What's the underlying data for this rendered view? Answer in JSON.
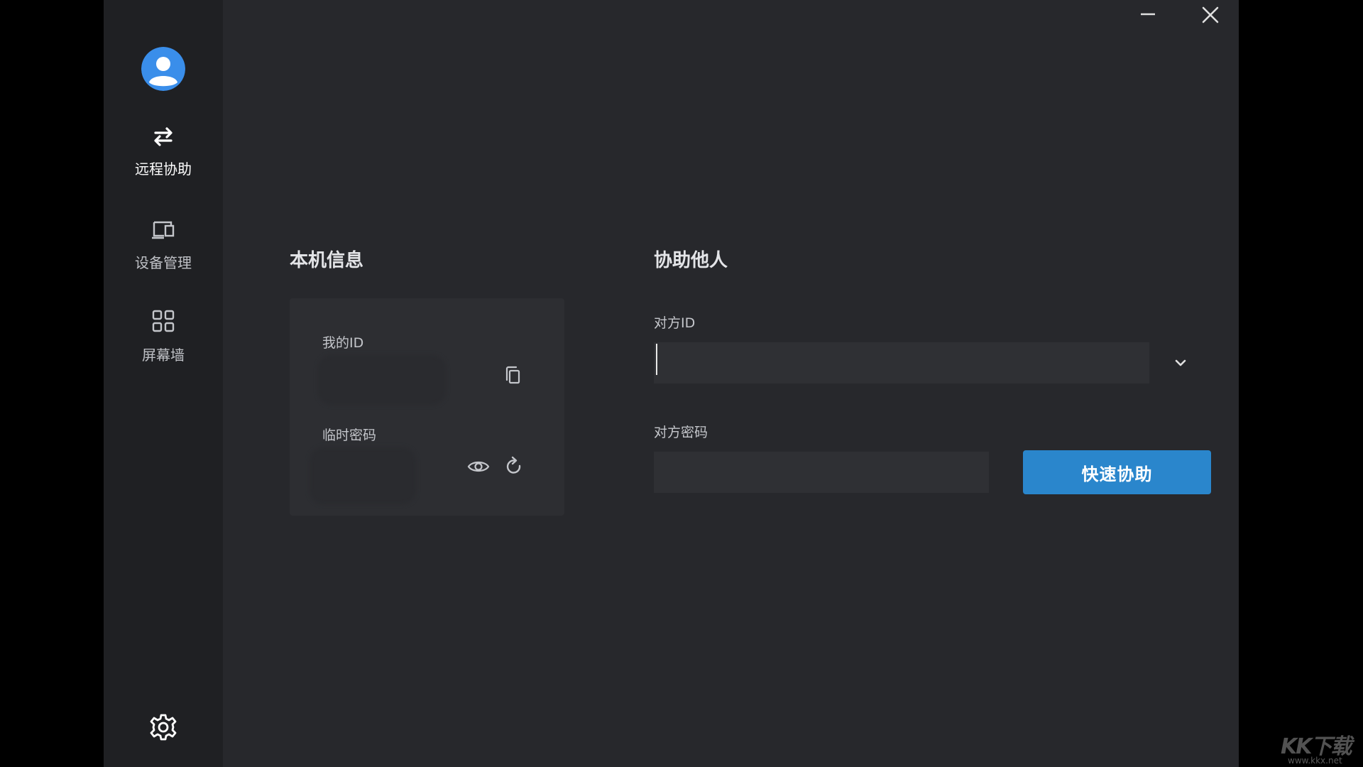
{
  "sidebar": {
    "items": [
      {
        "label": "远程协助",
        "icon": "swap-arrows-icon",
        "active": true
      },
      {
        "label": "设备管理",
        "icon": "devices-icon",
        "active": false
      },
      {
        "label": "屏幕墙",
        "icon": "grid-icon",
        "active": false
      }
    ],
    "settings_icon": "gear-icon",
    "avatar_icon": "user-avatar-icon"
  },
  "window_controls": {
    "minimize_icon": "minimize-icon",
    "close_icon": "close-icon"
  },
  "local_info": {
    "title": "本机信息",
    "my_id_label": "我的ID",
    "temp_password_label": "临时密码"
  },
  "assist": {
    "title": "协助他人",
    "peer_id_label": "对方ID",
    "peer_password_label": "对方密码",
    "quick_assist_label": "快速协助"
  },
  "watermark": {
    "logo_text": "KK下载",
    "url": "www.kkx.net"
  },
  "colors": {
    "accent": "#2a86cc",
    "avatar": "#3a8eea",
    "window_bg": "#27282c",
    "sidebar_bg": "#1f2023"
  }
}
